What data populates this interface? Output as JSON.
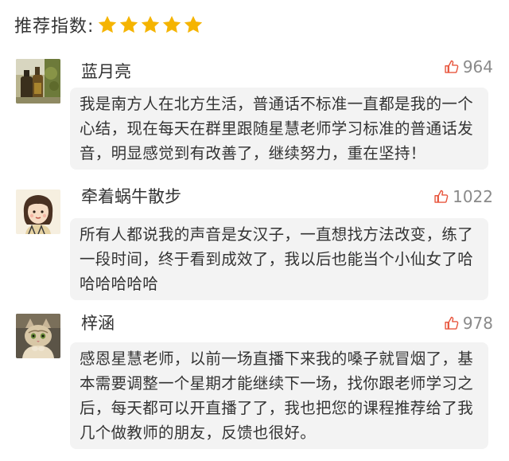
{
  "rating": {
    "label": "推荐指数:",
    "stars": 5,
    "star_color": "#f5b400"
  },
  "colors": {
    "like_icon": "#e8573f",
    "bubble_bg": "#f3f3f3",
    "like_count": "#8a8a8a"
  },
  "comments": [
    {
      "username": "蓝月亮",
      "likes": "964",
      "avatar": "bottles-photo-avatar",
      "text": "我是南方人在北方生活，普通话不标准一直都是我的一个心结，现在每天在群里跟随星慧老师学习标准的普通话发音，明显感觉到有改善了，继续努力，重在坚持！"
    },
    {
      "username": "牵着蜗牛散步",
      "likes": "1022",
      "avatar": "cartoon-girl-avatar",
      "text": "所有人都说我的声音是女汉子，一直想找方法改变，练了一段时间，终于看到成效了，我以后也能当个小仙女了哈哈哈哈哈哈"
    },
    {
      "username": "梓涵",
      "likes": "978",
      "avatar": "cat-photo-avatar",
      "text": "感恩星慧老师，以前一场直播下来我的嗓子就冒烟了，基本需要调整一个星期才能继续下一场，找你跟老师学习之后，每天都可以开直播了了，我也把您的课程推荐给了我几个做教师的朋友，反馈也很好。"
    }
  ]
}
